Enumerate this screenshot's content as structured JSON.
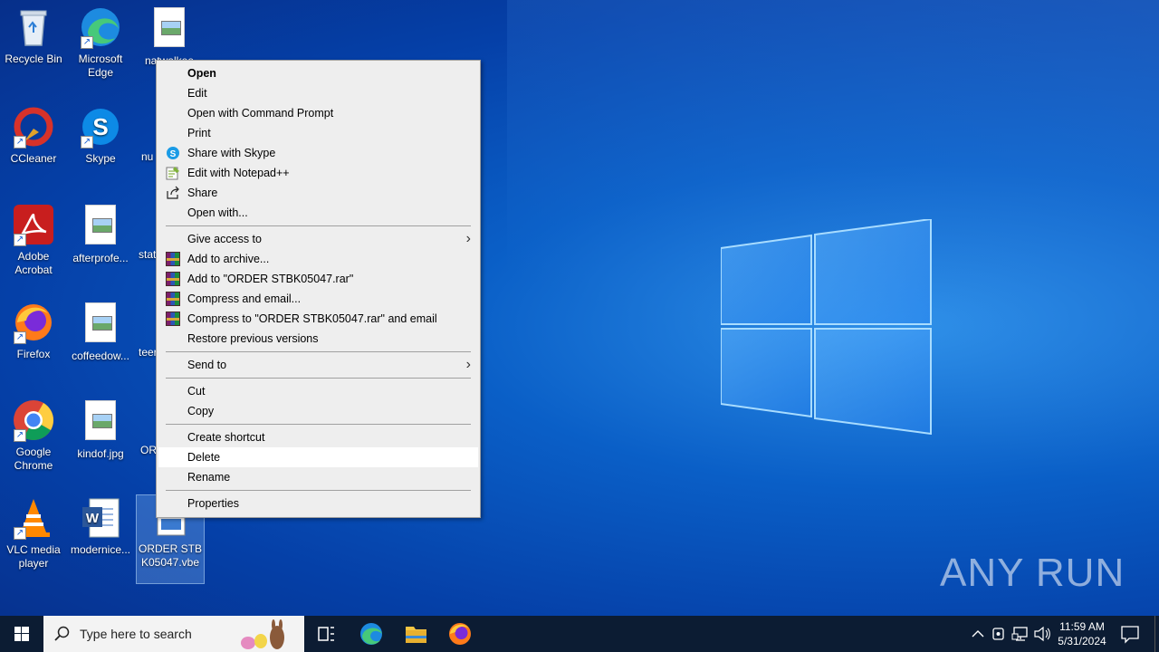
{
  "desktop": {
    "icons": [
      {
        "label": "Recycle Bin"
      },
      {
        "label": "Microsoft Edge"
      },
      {
        "label": "CCleaner"
      },
      {
        "label": "Skype"
      },
      {
        "label": "Adobe Acrobat"
      },
      {
        "label": "afterprofe..."
      },
      {
        "label": "Firefox"
      },
      {
        "label": "coffeedow..."
      },
      {
        "label": "Google Chrome"
      },
      {
        "label": "kindof.jpg"
      },
      {
        "label": "VLC media player"
      },
      {
        "label": "modernice..."
      },
      {
        "label": "ORDER STBK05047.vbe"
      }
    ],
    "partial_labels": [
      "natwalkee",
      "nu",
      "stat",
      "teer",
      "OR"
    ]
  },
  "context_menu": {
    "items": [
      {
        "label": "Open"
      },
      {
        "label": "Edit"
      },
      {
        "label": "Open with Command Prompt"
      },
      {
        "label": "Print"
      },
      {
        "label": "Share with Skype",
        "icon": "skype-icon"
      },
      {
        "label": "Edit with Notepad++",
        "icon": "notepad-plus-plus-icon"
      },
      {
        "label": "Share",
        "icon": "share-icon"
      },
      {
        "label": "Open with..."
      },
      {
        "label": "Give access to"
      },
      {
        "label": "Add to archive...",
        "icon": "winrar-icon"
      },
      {
        "label": "Add to \"ORDER STBK05047.rar\"",
        "icon": "winrar-icon"
      },
      {
        "label": "Compress and email...",
        "icon": "winrar-icon"
      },
      {
        "label": "Compress to \"ORDER STBK05047.rar\" and email",
        "icon": "winrar-icon"
      },
      {
        "label": "Restore previous versions"
      },
      {
        "label": "Send to"
      },
      {
        "label": "Cut"
      },
      {
        "label": "Copy"
      },
      {
        "label": "Create shortcut"
      },
      {
        "label": "Delete"
      },
      {
        "label": "Rename"
      },
      {
        "label": "Properties"
      }
    ]
  },
  "taskbar": {
    "search_placeholder": "Type here to search",
    "time": "11:59 AM",
    "date": "5/31/2024"
  },
  "watermark": "ANY RUN",
  "colors": {
    "accent": "#0a5fc7",
    "menu_bg": "#eeeeee",
    "taskbar_bg": "#0c1c33"
  }
}
